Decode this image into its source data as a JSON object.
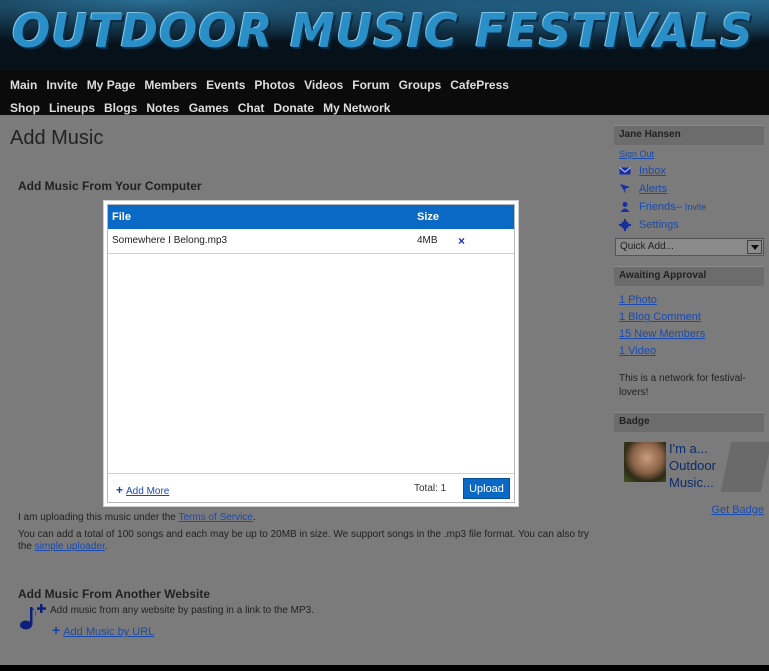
{
  "site": {
    "title": "OUTDOOR MUSIC FESTIVALS",
    "nav": [
      "Main",
      "Invite",
      "My Page",
      "Members",
      "Events",
      "Photos",
      "Videos",
      "Forum",
      "Groups",
      "CafePress Shop",
      "Lineups",
      "Blogs",
      "Notes",
      "Games",
      "Chat",
      "Donate",
      "My Network"
    ]
  },
  "main": {
    "page_title": "Add Music",
    "computer_heading": "Add Music From Your Computer",
    "tos_prefix": "I am uploading this music under the ",
    "tos_link": "Terms of Service",
    "tos_suffix": ".",
    "limits_text": "You can add a total of 100 songs and each may be up to 20MB in size. We support songs in the .mp3 file format. You can also try the ",
    "simple_uploader": "simple uploader",
    "limits_suffix": ".",
    "website_heading": "Add Music From Another Website",
    "url_desc": "Add music from any website by pasting in a link to the MP3.",
    "add_url_label": "Add Music by URL"
  },
  "uploader": {
    "col_file": "File",
    "col_size": "Size",
    "files": [
      {
        "name": "Somewhere I Belong.mp3",
        "size": "4MB",
        "delete": "×"
      }
    ],
    "add_more": "Add More",
    "total": "Total: 1",
    "upload_label": "Upload"
  },
  "sidebar": {
    "user_name": "Jane Hansen",
    "sign_out": "Sign Out",
    "inbox": "Inbox",
    "alerts": "Alerts",
    "friends": "Friends",
    "friends_sep": " – ",
    "invite": "Invite",
    "settings": "Settings",
    "quick_add": "Quick Add...",
    "approval_heading": "Awaiting Approval",
    "approval_items": [
      "1 Photo",
      "1 Blog Comment",
      "15 New Members",
      "1 Video"
    ],
    "network_desc": "This is a network for festival-lovers!",
    "badge_heading": "Badge",
    "badge_line1": "I'm a...",
    "badge_line2": "Outdoor",
    "badge_line3": "Music...",
    "get_badge": "Get Badge"
  },
  "colors": {
    "accent": "#0b69c6",
    "page_bg": "#7b7b7b",
    "link": "#1a4bb0"
  }
}
